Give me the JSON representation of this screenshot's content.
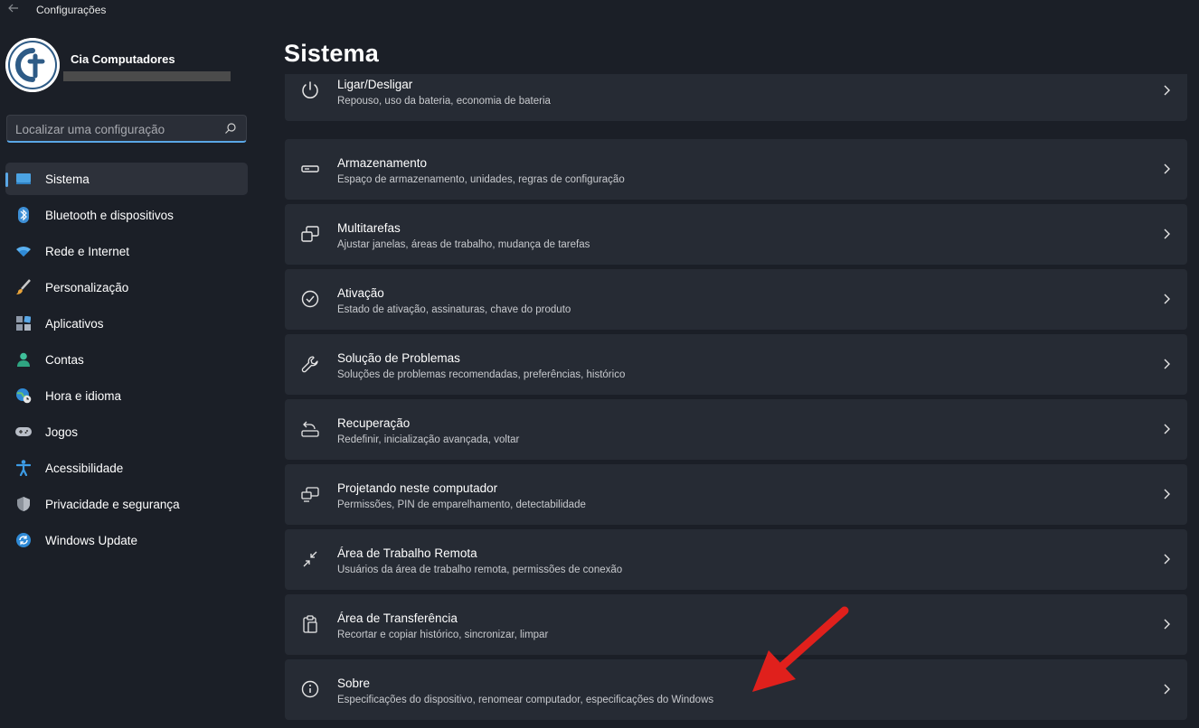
{
  "window": {
    "title": "Configurações"
  },
  "profile": {
    "name": "Cia Computadores"
  },
  "search": {
    "placeholder": "Localizar uma configuração"
  },
  "sidebar": {
    "items": [
      {
        "label": "Sistema",
        "icon": "monitor-icon",
        "active": true
      },
      {
        "label": "Bluetooth e dispositivos",
        "icon": "bluetooth-icon"
      },
      {
        "label": "Rede e Internet",
        "icon": "wifi-icon"
      },
      {
        "label": "Personalização",
        "icon": "brush-icon"
      },
      {
        "label": "Aplicativos",
        "icon": "apps-icon"
      },
      {
        "label": "Contas",
        "icon": "person-icon"
      },
      {
        "label": "Hora e idioma",
        "icon": "globe-clock-icon"
      },
      {
        "label": "Jogos",
        "icon": "gamepad-icon"
      },
      {
        "label": "Acessibilidade",
        "icon": "accessibility-icon"
      },
      {
        "label": "Privacidade e segurança",
        "icon": "shield-icon"
      },
      {
        "label": "Windows Update",
        "icon": "update-icon"
      }
    ]
  },
  "main": {
    "title": "Sistema",
    "items": [
      {
        "title": "Ligar/Desligar",
        "subtitle": "Repouso, uso da bateria, economia de bateria",
        "icon": "power-icon"
      },
      {
        "title": "Armazenamento",
        "subtitle": "Espaço de armazenamento, unidades, regras de configuração",
        "icon": "storage-icon"
      },
      {
        "title": "Multitarefas",
        "subtitle": "Ajustar janelas, áreas de trabalho, mudança de tarefas",
        "icon": "multitasking-icon"
      },
      {
        "title": "Ativação",
        "subtitle": "Estado de ativação, assinaturas, chave do produto",
        "icon": "check-circle-icon"
      },
      {
        "title": "Solução de Problemas",
        "subtitle": "Soluções de problemas recomendadas, preferências, histórico",
        "icon": "wrench-icon"
      },
      {
        "title": "Recuperação",
        "subtitle": "Redefinir, inicialização avançada, voltar",
        "icon": "recovery-icon"
      },
      {
        "title": "Projetando neste computador",
        "subtitle": "Permissões, PIN de emparelhamento, detectabilidade",
        "icon": "projecting-icon"
      },
      {
        "title": "Área de Trabalho Remota",
        "subtitle": "Usuários da área de trabalho remota, permissões de conexão",
        "icon": "remote-desktop-icon"
      },
      {
        "title": "Área de Transferência",
        "subtitle": "Recortar e copiar histórico, sincronizar, limpar",
        "icon": "clipboard-icon"
      },
      {
        "title": "Sobre",
        "subtitle": "Especificações do dispositivo, renomear computador, especificações do Windows",
        "icon": "info-icon"
      }
    ]
  },
  "colors": {
    "accent": "#5aa7e6",
    "background": "#1b1f27",
    "card": "#262b34",
    "annotation": "#e0201c"
  }
}
